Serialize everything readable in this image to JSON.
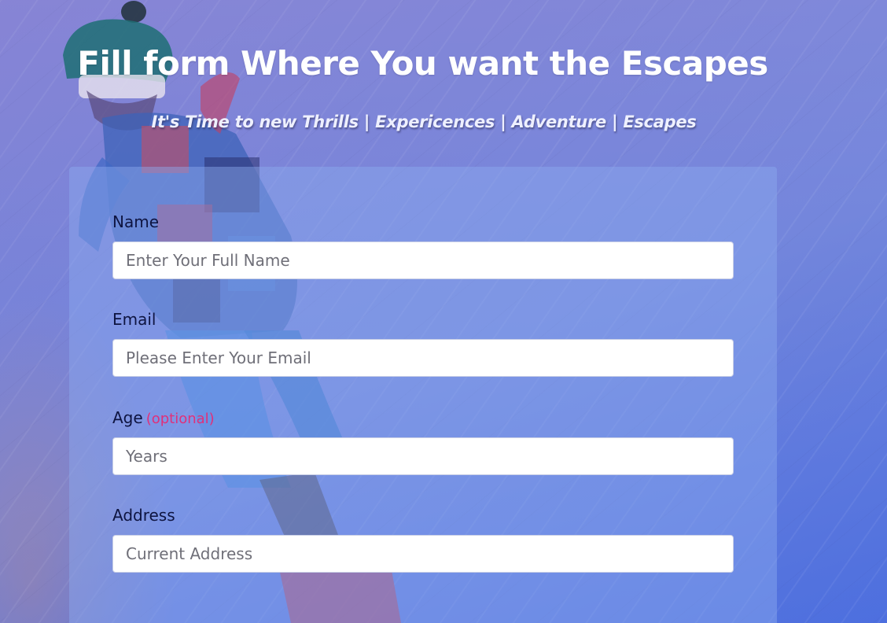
{
  "header": {
    "title": "Fill form Where You want the Escapes",
    "subtitle": "It's Time to new Thrills | Expericences | Adventure | Escapes"
  },
  "form": {
    "fields": [
      {
        "label": "Name",
        "placeholder": "Enter Your Full Name",
        "value": ""
      },
      {
        "label": "Email",
        "placeholder": "Please Enter Your Email",
        "value": ""
      },
      {
        "label": "Age",
        "optional_note": "(optional)",
        "placeholder": "Years",
        "value": ""
      },
      {
        "label": "Address",
        "placeholder": "Current Address",
        "value": ""
      }
    ]
  },
  "colors": {
    "label_text": "#0e1440",
    "optional_accent": "#e0307a",
    "heading_text": "#ffffff"
  }
}
